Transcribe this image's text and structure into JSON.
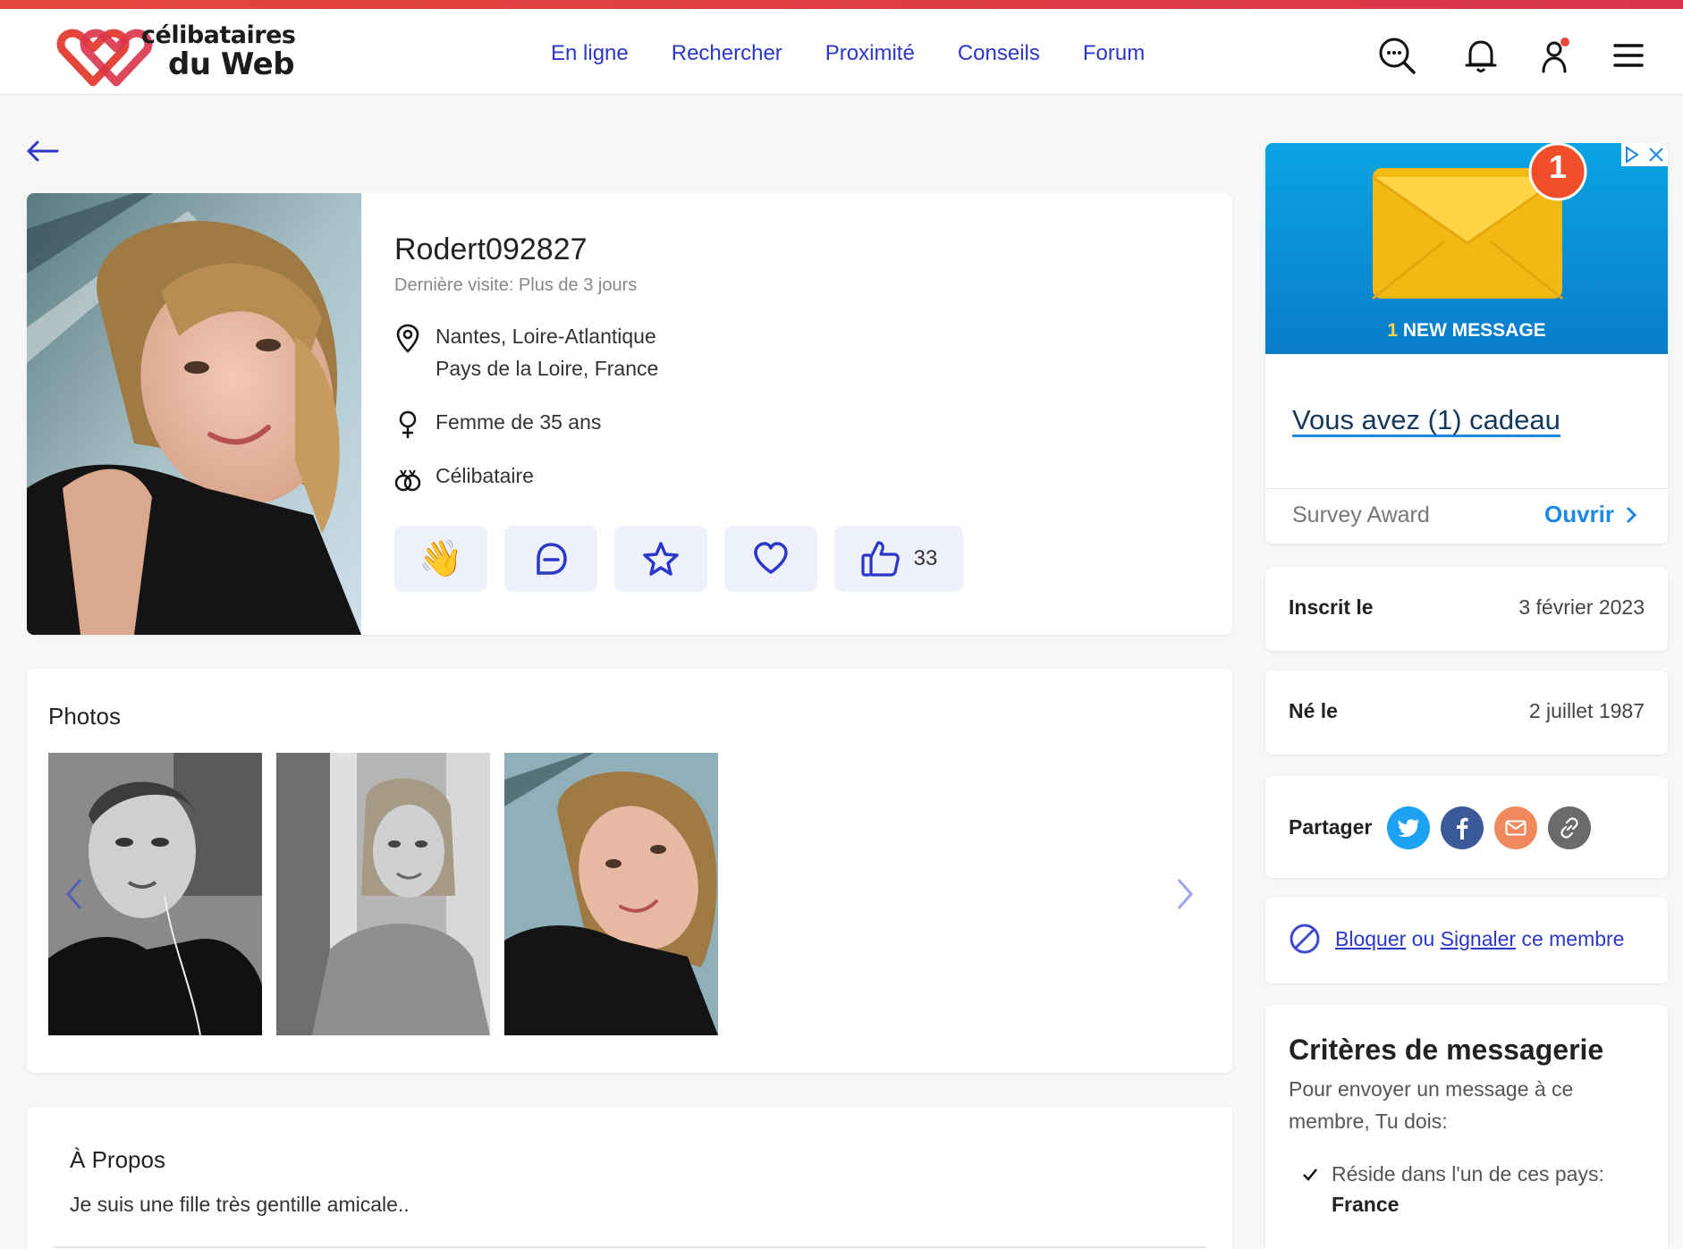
{
  "header": {
    "logo_line1": "célibataires",
    "logo_line2": "du Web",
    "nav": [
      "En ligne",
      "Rechercher",
      "Proximité",
      "Conseils",
      "Forum"
    ]
  },
  "profile": {
    "username": "Rodert092827",
    "last_visit": "Dernière visite: Plus de 3 jours",
    "location_line1": "Nantes, Loire-Atlantique",
    "location_line2": "Pays de la Loire, France",
    "gender_age": "Femme de 35 ans",
    "status": "Célibataire",
    "likes": "33",
    "wave_emoji": "👋"
  },
  "photos": {
    "title": "Photos"
  },
  "about": {
    "title": "À Propos",
    "text": "Je suis une fille très gentille amicale.."
  },
  "ad": {
    "badge": "1",
    "new_message_num": "1",
    "new_message_text": " NEW MESSAGE",
    "title": "Vous avez (1) cadeau",
    "sponsor": "Survey Award",
    "open": "Ouvrir"
  },
  "meta": {
    "registered_label": "Inscrit le",
    "registered_value": "3 février 2023",
    "born_label": "Né le",
    "born_value": "2 juillet 1987"
  },
  "share": {
    "label": "Partager"
  },
  "block": {
    "block_link": "Bloquer",
    "or": "ou",
    "report_link": "Signaler",
    "suffix": "ce membre"
  },
  "criteria": {
    "title": "Critères de messagerie",
    "description": "Pour envoyer un message à ce membre, Tu dois:",
    "item_text": "Réside dans l'un de ces pays:",
    "item_value": "France"
  },
  "colors": {
    "accent_blue": "#2b37c9",
    "brand_red": "#e5463c",
    "twitter": "#1da1f2",
    "facebook": "#3b5998",
    "email": "#f08a5d",
    "link": "#6b6b6b"
  }
}
